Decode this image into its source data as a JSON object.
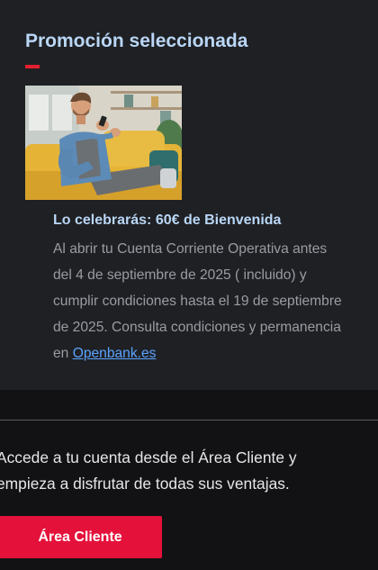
{
  "promo": {
    "title": "Promoción seleccionada",
    "heading": "Lo celebrarás: 60€ de Bienvenida",
    "body_lines": [
      "Al abrir tu Cuenta Corriente Operativa antes",
      "del 4 de septiembre de 2025 ( incluido) y",
      "cumplir condiciones hasta el 19 de septiembre",
      "de 2025. Consulta condiciones y permanencia"
    ],
    "body_last_prefix": "en ",
    "link_text": "Openbank.es",
    "image_alt": "Hombre sonriente sentado en un sofá amarillo usando su móvil"
  },
  "access": {
    "lines": [
      "Accede a tu cuenta desde el Área Cliente y",
      "empieza a disfrutar de todas sus ventajas."
    ],
    "button_label": "Área Cliente"
  },
  "colors": {
    "accent_red": "#e4202f",
    "button_red": "#e4113a",
    "title_blue": "#b9d6f5",
    "link_blue": "#5aa3ff"
  }
}
